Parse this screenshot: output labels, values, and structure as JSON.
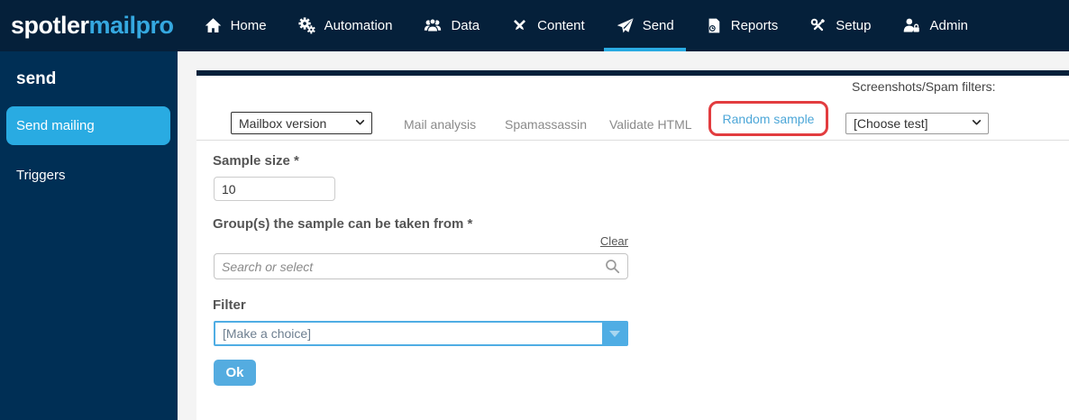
{
  "brand": {
    "logo_primary": "spotler",
    "logo_secondary": "mailpro"
  },
  "navbar": {
    "items": [
      {
        "label": "Home",
        "icon": "home-icon",
        "active": false
      },
      {
        "label": "Automation",
        "icon": "gears-icon",
        "active": false
      },
      {
        "label": "Data",
        "icon": "people-icon",
        "active": false
      },
      {
        "label": "Content",
        "icon": "pens-icon",
        "active": false
      },
      {
        "label": "Send",
        "icon": "paper-plane-icon",
        "active": true
      },
      {
        "label": "Reports",
        "icon": "report-icon",
        "active": false
      },
      {
        "label": "Setup",
        "icon": "tools-icon",
        "active": false
      },
      {
        "label": "Admin",
        "icon": "user-lock-icon",
        "active": false
      }
    ]
  },
  "sidebar": {
    "title": "send",
    "items": [
      {
        "label": "Send mailing",
        "active": true
      },
      {
        "label": "Triggers",
        "active": false
      }
    ]
  },
  "tabs": {
    "version_select": {
      "value": "Mailbox version"
    },
    "items": [
      {
        "label": "Mail analysis",
        "active": false
      },
      {
        "label": "Spamassassin",
        "active": false
      },
      {
        "label": "Validate HTML",
        "active": false
      },
      {
        "label": "Random sample",
        "active": true,
        "annotated": true
      }
    ],
    "filters_label": "Screenshots/Spam filters:",
    "filters_select": {
      "value": "[Choose test]"
    }
  },
  "form": {
    "sample_size": {
      "label": "Sample size *",
      "value": "10"
    },
    "groups": {
      "label": "Group(s) the sample can be taken from *",
      "clear_label": "Clear",
      "search_placeholder": "Search or select"
    },
    "filter": {
      "label": "Filter",
      "value": "[Make a choice]"
    },
    "ok_label": "Ok"
  },
  "colors": {
    "navbar_bg": "#05203a",
    "sidebar_bg": "#002f55",
    "accent_blue": "#29abe2",
    "logo_blue": "#35a8e0",
    "active_tab_text": "#4da7d8",
    "annotation_red": "#e23c3f",
    "button_blue": "#54ace0"
  }
}
